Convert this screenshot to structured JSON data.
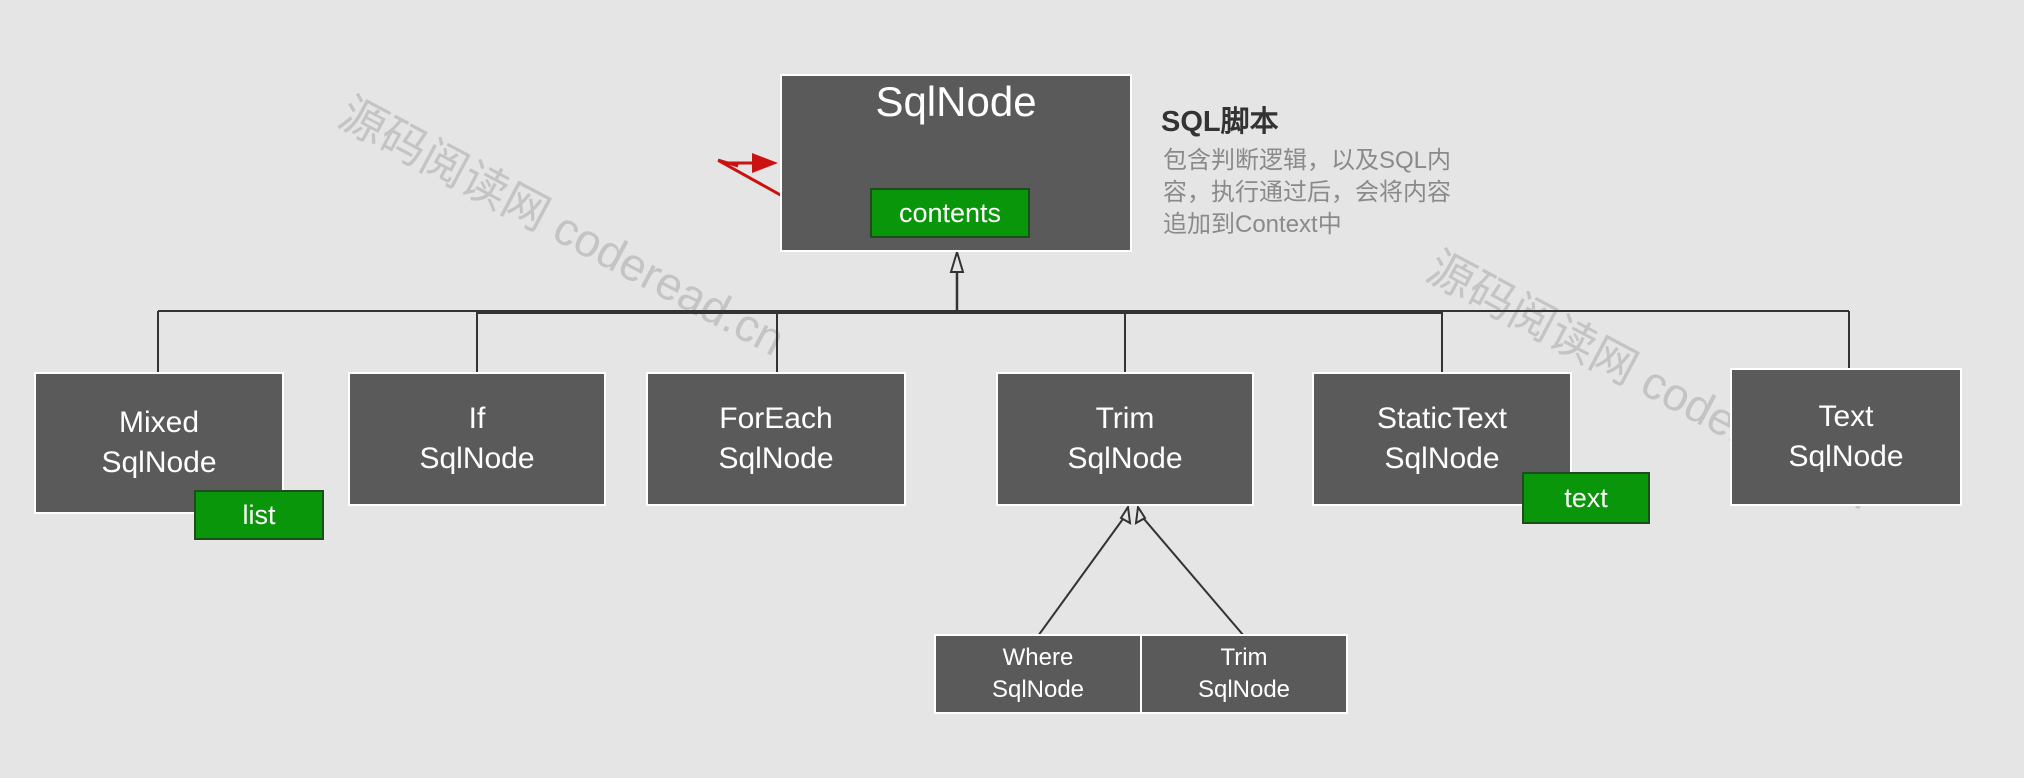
{
  "diagram": {
    "root": {
      "title": "SqlNode",
      "tag": "contents"
    },
    "note": {
      "title": "SQL脚本",
      "lines": [
        "包含判断逻辑，以及SQL内",
        "容，执行通过后，会将内容",
        "追加到Context中"
      ]
    },
    "children": [
      {
        "line1": "Mixed",
        "line2": "SqlNode",
        "tag": "list"
      },
      {
        "line1": "If",
        "line2": "SqlNode"
      },
      {
        "line1": "ForEach",
        "line2": "SqlNode"
      },
      {
        "line1": "Trim",
        "line2": "SqlNode"
      },
      {
        "line1": "StaticText",
        "line2": "SqlNode",
        "tag": "text"
      },
      {
        "line1": "Text",
        "line2": "SqlNode"
      }
    ],
    "trim_children": [
      {
        "line1": "Where",
        "line2": "SqlNode"
      },
      {
        "line1": "Trim",
        "line2": "SqlNode"
      }
    ],
    "watermarks": [
      "源码阅读网 coderead.cn",
      "源码阅读网 coderead.cn"
    ]
  },
  "colors": {
    "box": "#5a5a5a",
    "tag": "#0a960a",
    "arrow": "#cc1111",
    "background": "#e5e5e5",
    "note_text": "#8a8a8a"
  }
}
